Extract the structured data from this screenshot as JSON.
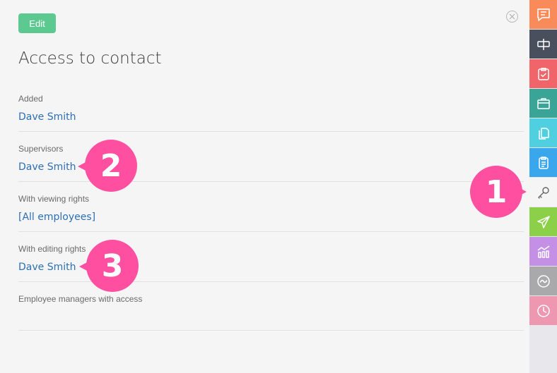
{
  "toolbar": {
    "edit_label": "Edit"
  },
  "page": {
    "title": "Access to contact"
  },
  "sections": [
    {
      "label": "Added",
      "value": "Dave Smith"
    },
    {
      "label": "Supervisors",
      "value": "Dave Smith"
    },
    {
      "label": "With viewing rights",
      "value": "[All employees]"
    },
    {
      "label": "With editing rights",
      "value": "Dave Smith"
    },
    {
      "label": "Employee managers with access",
      "value": ""
    }
  ],
  "callouts": [
    "1",
    "2",
    "3"
  ],
  "sidebar": {
    "tabs": [
      {
        "icon": "chat-icon",
        "color": "#f98a5a"
      },
      {
        "icon": "sign-icon",
        "color": "#4a4f5e"
      },
      {
        "icon": "clipboard-check-icon",
        "color": "#f0656a"
      },
      {
        "icon": "briefcase-icon",
        "color": "#3aa597"
      },
      {
        "icon": "documents-icon",
        "color": "#4fcfe0"
      },
      {
        "icon": "receipt-icon",
        "color": "#3aa6ec"
      },
      {
        "icon": "key-icon",
        "color": "#f5f5f5"
      },
      {
        "icon": "send-icon",
        "color": "#8cd049"
      },
      {
        "icon": "analytics-icon",
        "color": "#c490e6"
      },
      {
        "icon": "activity-icon",
        "color": "#a9a9ac"
      },
      {
        "icon": "clock-icon",
        "color": "#ee97b0"
      }
    ]
  },
  "colors": {
    "accent": "#5cc990",
    "link": "#2d6fb3",
    "callout": "#ff4fa0"
  }
}
